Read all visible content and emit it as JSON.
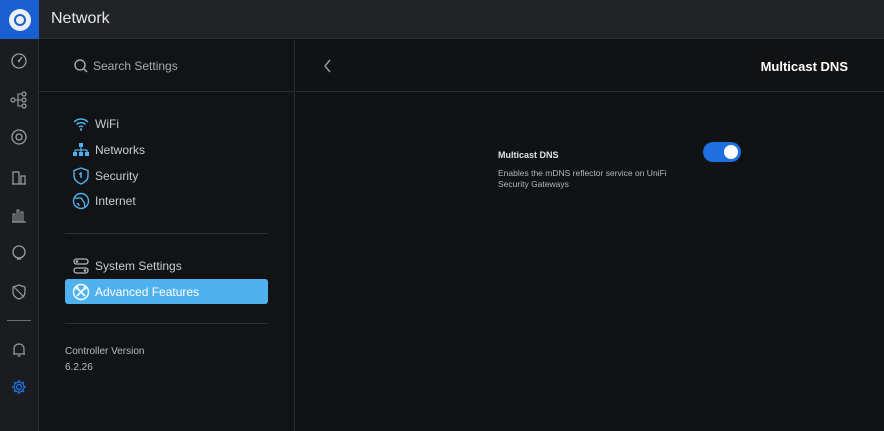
{
  "app": {
    "title": "Network"
  },
  "rail": {
    "icons": [
      "dashboard-icon",
      "topology-icon",
      "devices-icon",
      "statistics-icon",
      "insights-icon",
      "events-icon",
      "alerts-shield-icon",
      "notifications-bell-icon",
      "settings-gear-icon"
    ],
    "active": "settings-gear-icon",
    "active_color": "#1f6fe0"
  },
  "search": {
    "placeholder": "Search Settings"
  },
  "nav": {
    "group1": [
      {
        "label": "WiFi",
        "icon": "wifi-icon"
      },
      {
        "label": "Networks",
        "icon": "networks-icon"
      },
      {
        "label": "Security",
        "icon": "security-shield-icon"
      },
      {
        "label": "Internet",
        "icon": "internet-globe-icon"
      }
    ],
    "group2": [
      {
        "label": "System Settings",
        "icon": "system-settings-icon"
      },
      {
        "label": "Advanced Features",
        "icon": "advanced-features-icon",
        "active": true
      }
    ],
    "active_bg": "#4fb2ee"
  },
  "controller": {
    "label": "Controller Version",
    "value": "6.2.26"
  },
  "main": {
    "title": "Multicast DNS",
    "setting": {
      "title": "Multicast DNS",
      "description": "Enables the mDNS reflector service on UniFi Security Gateways",
      "enabled": true
    }
  }
}
